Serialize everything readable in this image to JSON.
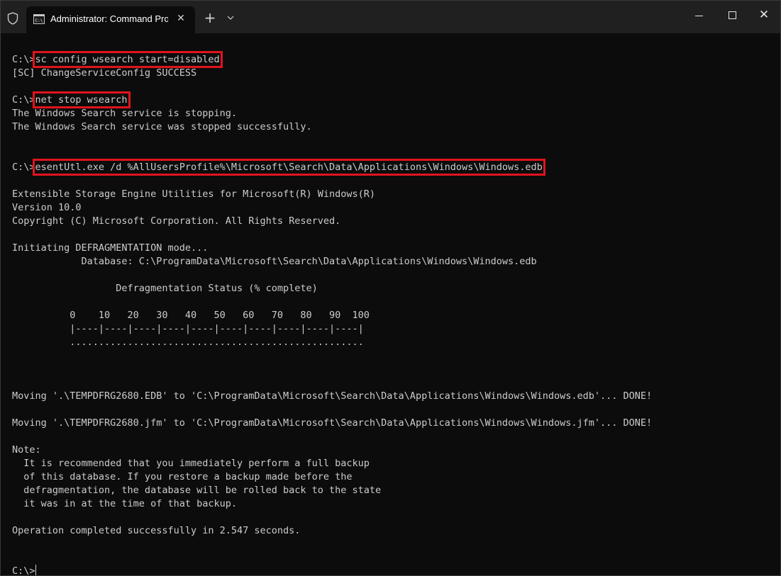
{
  "window": {
    "tab_title": "Administrator: Command Prompt",
    "tab_icon": "cmd-icon",
    "shield_icon": "shield-icon",
    "close_tab_glyph": "✕",
    "new_tab_glyph": "+",
    "dropdown_glyph": "⌄",
    "minimize_label": "Minimize",
    "maximize_label": "Maximize",
    "close_glyph": "✕"
  },
  "console": {
    "prompt": "C:\\>",
    "lines": [
      {
        "prompt": "C:\\>",
        "cmd": "sc config wsearch start=disabled"
      },
      {
        "text": "[SC] ChangeServiceConfig SUCCESS"
      },
      {
        "text": ""
      },
      {
        "prompt": "C:\\>",
        "cmd": "net stop wsearch"
      },
      {
        "text": "The Windows Search service is stopping."
      },
      {
        "text": "The Windows Search service was stopped successfully."
      },
      {
        "text": ""
      },
      {
        "text": ""
      },
      {
        "prompt": "C:\\>",
        "cmd": "esentUtl.exe /d %AllUsersProfile%\\Microsoft\\Search\\Data\\Applications\\Windows\\Windows.edb"
      },
      {
        "text": ""
      },
      {
        "text": "Extensible Storage Engine Utilities for Microsoft(R) Windows(R)"
      },
      {
        "text": "Version 10.0"
      },
      {
        "text": "Copyright (C) Microsoft Corporation. All Rights Reserved."
      },
      {
        "text": ""
      },
      {
        "text": "Initiating DEFRAGMENTATION mode..."
      },
      {
        "text": "            Database: C:\\ProgramData\\Microsoft\\Search\\Data\\Applications\\Windows\\Windows.edb"
      },
      {
        "text": ""
      },
      {
        "text": "                  Defragmentation Status (% complete)"
      },
      {
        "text": ""
      },
      {
        "text": "          0    10   20   30   40   50   60   70   80   90  100"
      },
      {
        "text": "          |----|----|----|----|----|----|----|----|----|----|"
      },
      {
        "text": "          ..................................................."
      },
      {
        "text": ""
      },
      {
        "text": ""
      },
      {
        "text": ""
      },
      {
        "text": "Moving '.\\TEMPDFRG2680.EDB' to 'C:\\ProgramData\\Microsoft\\Search\\Data\\Applications\\Windows\\Windows.edb'... DONE!"
      },
      {
        "text": ""
      },
      {
        "text": "Moving '.\\TEMPDFRG2680.jfm' to 'C:\\ProgramData\\Microsoft\\Search\\Data\\Applications\\Windows\\Windows.jfm'... DONE!"
      },
      {
        "text": ""
      },
      {
        "text": "Note:"
      },
      {
        "text": "  It is recommended that you immediately perform a full backup"
      },
      {
        "text": "  of this database. If you restore a backup made before the"
      },
      {
        "text": "  defragmentation, the database will be rolled back to the state"
      },
      {
        "text": "  it was in at the time of that backup."
      },
      {
        "text": ""
      },
      {
        "text": "Operation completed successfully in 2.547 seconds."
      },
      {
        "text": ""
      },
      {
        "text": ""
      },
      {
        "prompt": "C:\\>",
        "cursor": true
      }
    ]
  },
  "colors": {
    "background": "#0c0c0c",
    "titlebar": "#202020",
    "text": "#cccccc",
    "highlight": "#e0141e"
  }
}
